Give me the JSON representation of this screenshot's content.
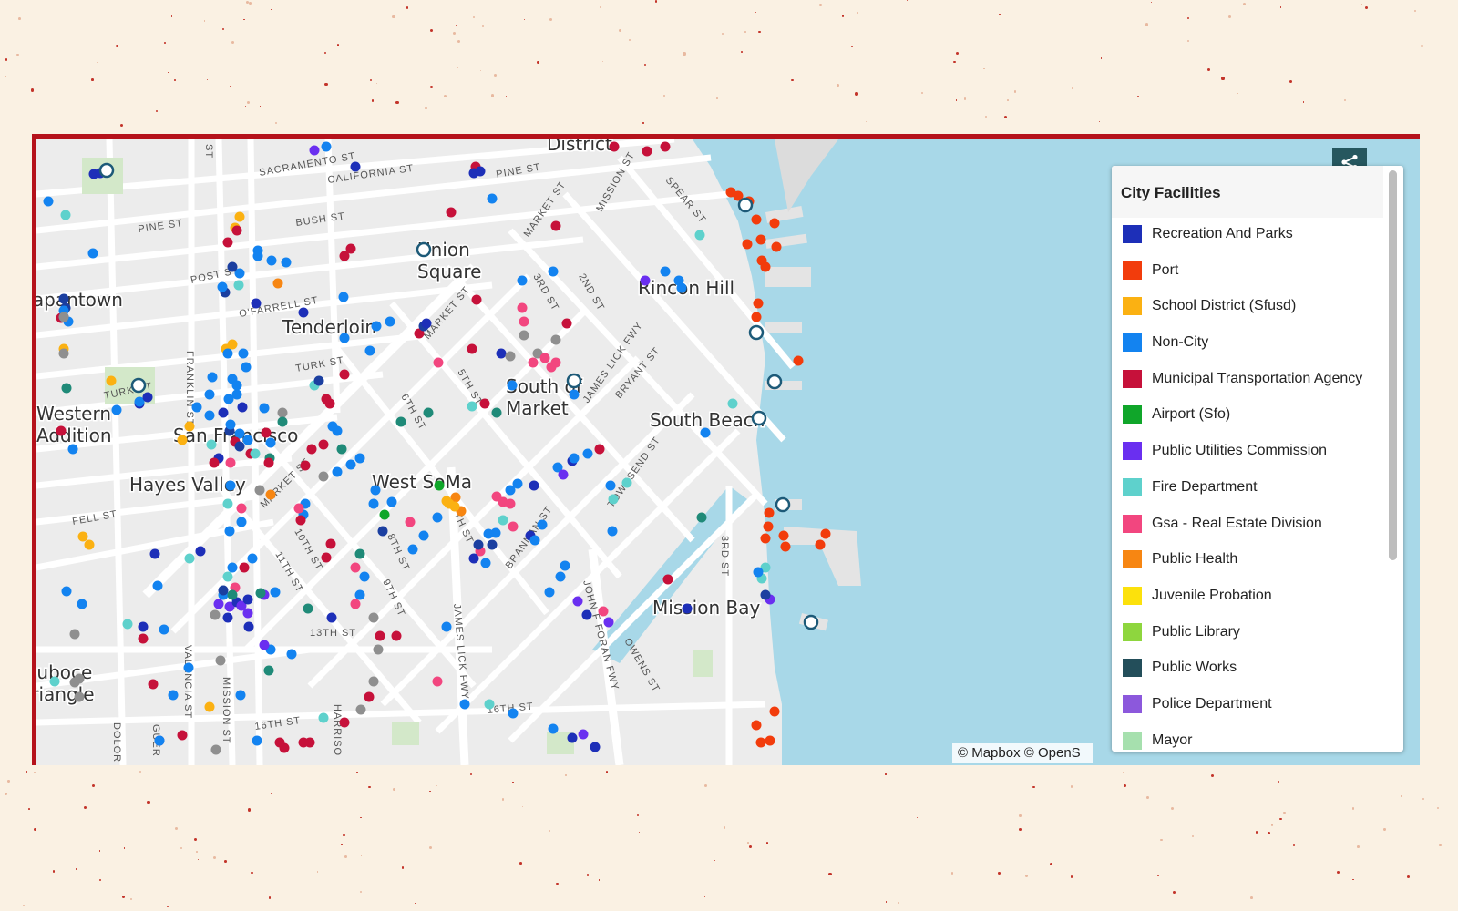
{
  "map": {
    "attribution": "© Mapbox © OpenS",
    "neighborhoods": [
      "District",
      "Union Square",
      "Rincon Hill",
      "Japantown",
      "Tenderloin",
      "South of Market",
      "Western Addition",
      "San Francisco",
      "South Beach",
      "Hayes Valley",
      "West SoMa",
      "Mission Bay",
      "Duboce Triangle"
    ],
    "streets": [
      "SACRAMENTO ST",
      "CALIFORNIA ST",
      "PINE ST",
      "PINE ST",
      "BUSH ST",
      "POST ST",
      "O'FARRELL ST",
      "TURK ST",
      "TURK ST",
      "FRANKLIN ST",
      "MARKET ST",
      "MISSION ST",
      "SPEAR ST",
      "MARKET ST",
      "3RD ST",
      "2ND ST",
      "MARKET ST",
      "5TH ST",
      "6TH ST",
      "JAMES LICK FWY",
      "BRYANT ST",
      "TOWNSEND ST",
      "BRANNAN ST",
      "7TH ST",
      "8TH ST",
      "9TH ST",
      "10TH ST",
      "11TH ST",
      "FELL ST",
      "13TH ST",
      "JAMES LICK FWY",
      "JOHN F FORAN FWY",
      "OWENS ST",
      "3RD ST",
      "16TH ST",
      "16TH ST",
      "VALENCIA ST",
      "MISSION ST",
      "HARRISO",
      "DOLOR",
      "GUER",
      "ST"
    ]
  },
  "share_button": {
    "icon": "share-icon"
  },
  "legend": {
    "title": "City Facilities",
    "items": [
      {
        "label": "Recreation And Parks",
        "color": "#1d2fb8"
      },
      {
        "label": "Port",
        "color": "#f23c0c"
      },
      {
        "label": "School District (Sfusd)",
        "color": "#fbb112"
      },
      {
        "label": "Non-City",
        "color": "#1383f0"
      },
      {
        "label": "Municipal Transportation Agency",
        "color": "#c6113a"
      },
      {
        "label": "Airport (Sfo)",
        "color": "#10a62a"
      },
      {
        "label": "Public Utilities Commission",
        "color": "#6a2ff0"
      },
      {
        "label": "Fire Department",
        "color": "#5ed1cc"
      },
      {
        "label": "Gsa - Real Estate Division",
        "color": "#f2467f"
      },
      {
        "label": "Public Health",
        "color": "#f78612"
      },
      {
        "label": "Juvenile Probation",
        "color": "#fce10c"
      },
      {
        "label": "Public Library",
        "color": "#8ed63e"
      },
      {
        "label": "Public Works",
        "color": "#234e5a"
      },
      {
        "label": "Police Department",
        "color": "#8c58dc"
      },
      {
        "label": "Mayor",
        "color": "#a6e0ae"
      }
    ]
  }
}
